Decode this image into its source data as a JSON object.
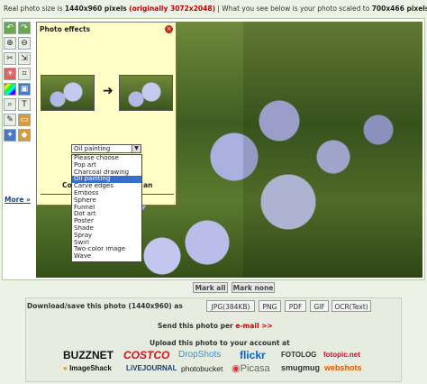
{
  "header": {
    "prefix": "Real photo size is ",
    "size": "1440x960 pixels",
    "original": "(originally 3072x2048)",
    "suffix": " | What you see below is your photo scaled to ",
    "scaled": "700x466 pixels"
  },
  "toolbar": {
    "more_label": "More »",
    "icons": [
      "rotate-left-icon",
      "rotate-right-icon",
      "zoom-in-icon",
      "zoom-out-icon",
      "scissors-icon",
      "resize-icon",
      "brightness-icon",
      "crop-icon",
      "color-icon",
      "frame-icon",
      "magnify-icon",
      "text-icon",
      "pencil-icon",
      "eraser-icon",
      "effects-icon",
      "sharpen-icon"
    ]
  },
  "effects_panel": {
    "title": "Photo effects",
    "label_left": "Co",
    "label_right": "an",
    "selected": "Oil painting",
    "options": [
      "Please choose",
      "Pop art",
      "Charcoal drawing",
      "Oil painting",
      "Carve edges",
      "Emboss",
      "Sphere",
      "Funnel",
      "Dot art",
      "Poster",
      "Shade",
      "Spray",
      "Swirl",
      "Two-color image",
      "Wave"
    ]
  },
  "marks": {
    "mark_all": "Mark all",
    "mark_none": "Mark none"
  },
  "download": {
    "label": "Download/save this photo (1440x960) as",
    "formats": [
      "JPG(384KB)",
      "PNG",
      "PDF",
      "GIF",
      "OCR(Text)"
    ]
  },
  "email": {
    "prefix": "Send this photo per ",
    "link": "e-mail >>"
  },
  "upload": {
    "label": "Upload this photo to your account at",
    "row1": [
      "BUZZNET",
      "COSTCO",
      "DropShots",
      "flickr",
      "FOTOLOG",
      "fotopic.net"
    ],
    "row2": [
      "ImageShack",
      "LiVEJOURNAL",
      "photobucket",
      "Picasa",
      "smugmug",
      "webshots"
    ]
  },
  "colors": {
    "accent_red": "#c40000",
    "panel_yellow": "#ffffc6",
    "selection_blue": "#3a6fc9"
  }
}
